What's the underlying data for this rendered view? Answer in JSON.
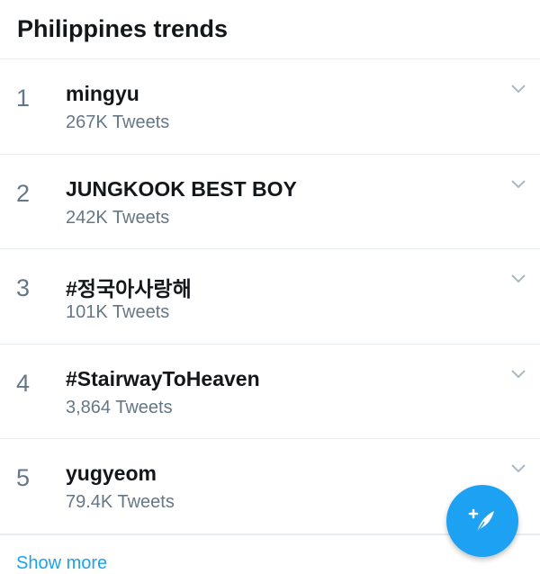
{
  "header": {
    "title": "Philippines trends"
  },
  "trends": [
    {
      "rank": "1",
      "name": "mingyu",
      "count": "267K Tweets"
    },
    {
      "rank": "2",
      "name": "JUNGKOOK BEST BOY",
      "count": "242K Tweets"
    },
    {
      "rank": "3",
      "name": "#정국아사랑해",
      "count": "101K Tweets"
    },
    {
      "rank": "4",
      "name": "#StairwayToHeaven",
      "count": "3,864 Tweets"
    },
    {
      "rank": "5",
      "name": "yugyeom",
      "count": "79.4K Tweets"
    }
  ],
  "footer": {
    "link_label": "Show more"
  },
  "icons": {
    "chevron": "chevron-down-icon",
    "compose": "compose-tweet-icon"
  },
  "colors": {
    "accent": "#1da1f2",
    "text": "#14171a",
    "secondary": "#657786",
    "divider": "#e6ecf0"
  }
}
